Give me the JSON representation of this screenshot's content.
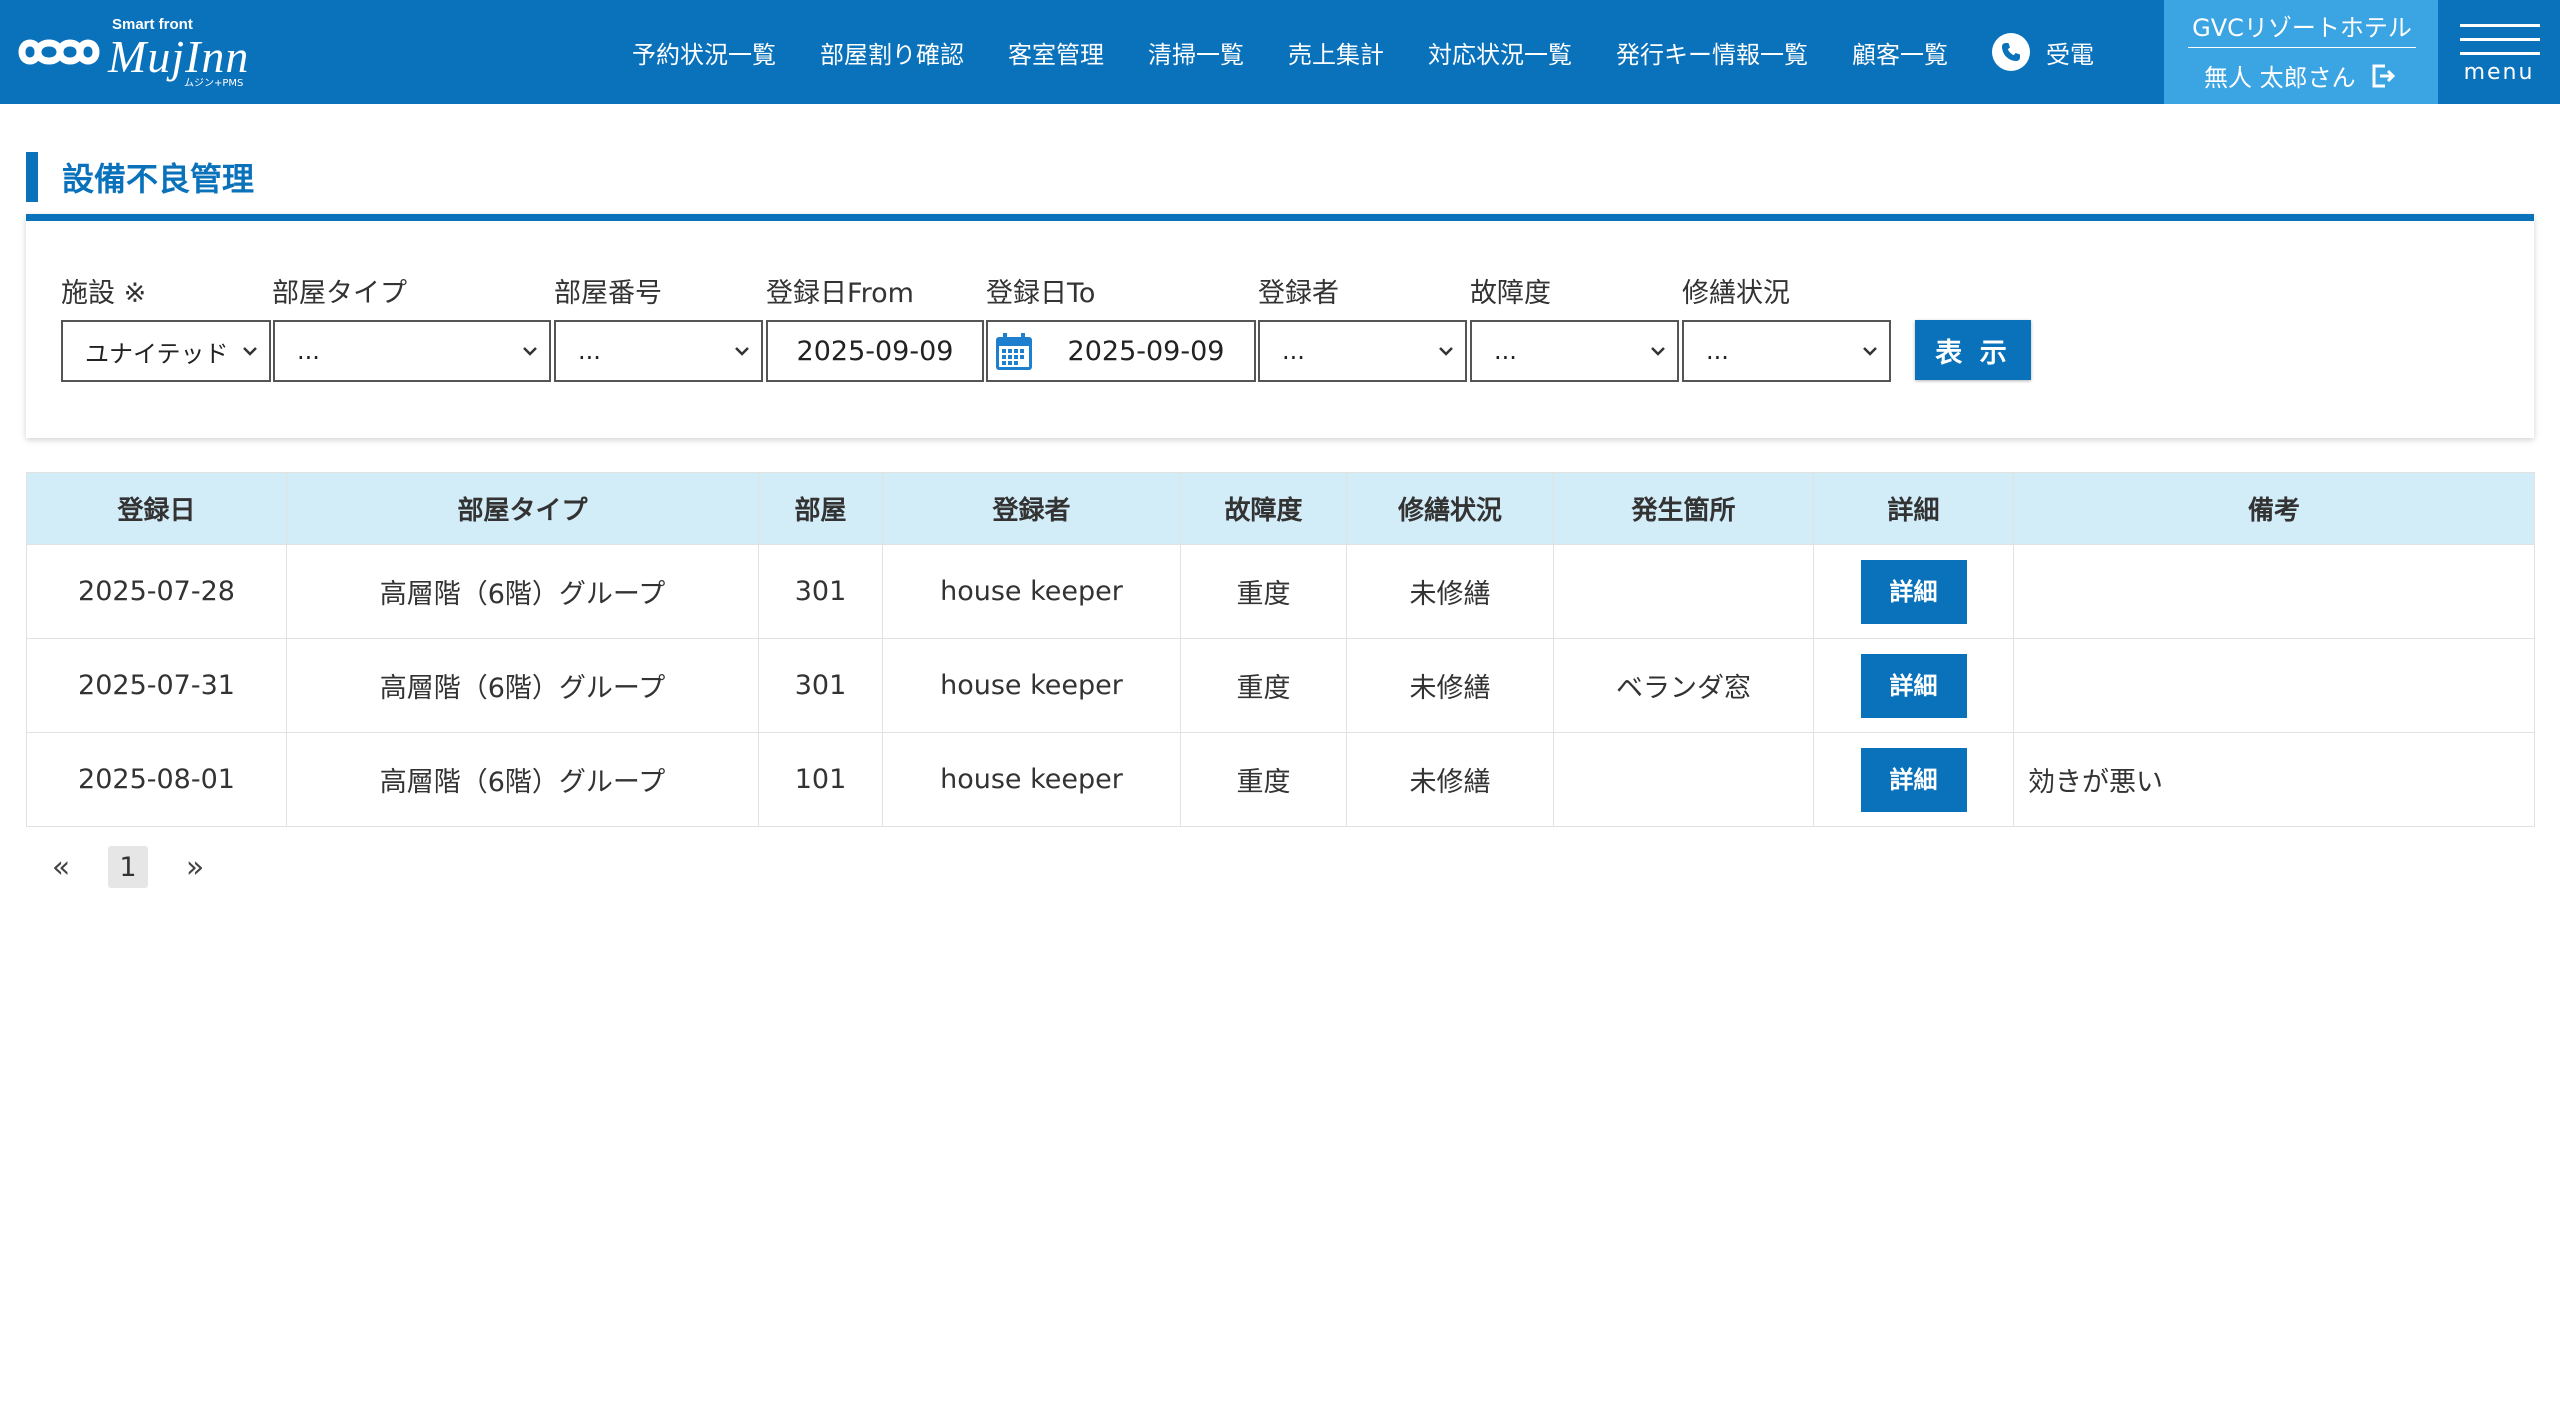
{
  "header": {
    "logo_small": "Smart front",
    "logo_main": "MujInn",
    "logo_sub": "ムジン+PMS",
    "nav": [
      "予約状況一覧",
      "部屋割り確認",
      "客室管理",
      "清掃一覧",
      "売上集計",
      "対応状況一覧",
      "発行キー情報一覧",
      "顧客一覧"
    ],
    "call_label": "受電",
    "hotel_name": "GVCリゾートホテル",
    "user_name": "無人 太郎さん",
    "menu_label": "menu"
  },
  "page": {
    "title": "設備不良管理"
  },
  "filters": {
    "facility": {
      "label": "施設 ※",
      "value": "ユナイテッド"
    },
    "room_type": {
      "label": "部屋タイプ",
      "value": "..."
    },
    "room_number": {
      "label": "部屋番号",
      "value": "..."
    },
    "date_from": {
      "label": "登録日From",
      "value": "2025-09-09"
    },
    "date_to": {
      "label": "登録日To",
      "value": "2025-09-09"
    },
    "registrant": {
      "label": "登録者",
      "value": "..."
    },
    "severity": {
      "label": "故障度",
      "value": "..."
    },
    "repair_status": {
      "label": "修繕状況",
      "value": "..."
    },
    "show_button": "表 示"
  },
  "table": {
    "headers": [
      "登録日",
      "部屋タイプ",
      "部屋",
      "登録者",
      "故障度",
      "修繕状況",
      "発生箇所",
      "詳細",
      "備考"
    ],
    "detail_label": "詳細",
    "rows": [
      {
        "date": "2025-07-28",
        "room_type": "高層階（6階）グループ",
        "room": "301",
        "registrant": "house keeper",
        "severity": "重度",
        "status": "未修繕",
        "location": "",
        "note": ""
      },
      {
        "date": "2025-07-31",
        "room_type": "高層階（6階）グループ",
        "room": "301",
        "registrant": "house keeper",
        "severity": "重度",
        "status": "未修繕",
        "location": "ベランダ窓",
        "note": ""
      },
      {
        "date": "2025-08-01",
        "room_type": "高層階（6階）グループ",
        "room": "101",
        "registrant": "house keeper",
        "severity": "重度",
        "status": "未修繕",
        "location": "",
        "note": "効きが悪い"
      }
    ]
  },
  "pagination": {
    "prev": "«",
    "current": "1",
    "next": "»"
  },
  "colors": {
    "primary": "#0a71bb",
    "hotel_box": "#3ba4e2",
    "table_header": "#d2ecf8"
  }
}
